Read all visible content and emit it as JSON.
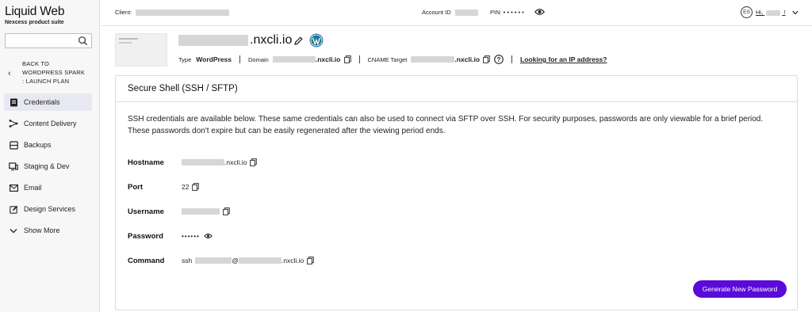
{
  "brand": {
    "name": "Liquid Web",
    "subtitle": "Nexcess product suite"
  },
  "sidebar": {
    "search_placeholder": "",
    "back_lines": [
      "BACK TO",
      "WORDPRESS SPARK",
      ": LAUNCH PLAN"
    ],
    "items": [
      {
        "label": "Credentials",
        "icon": "id-card-icon",
        "active": true
      },
      {
        "label": "Content Delivery",
        "icon": "network-icon"
      },
      {
        "label": "Backups",
        "icon": "archive-icon"
      },
      {
        "label": "Staging & Dev",
        "icon": "monitor-icon"
      },
      {
        "label": "Email",
        "icon": "envelope-icon"
      },
      {
        "label": "Design Services",
        "icon": "edit-icon"
      },
      {
        "label": "Show More",
        "icon": "chevron-down-icon"
      }
    ]
  },
  "topbar": {
    "client_label": "Client:",
    "account_label": "Account ID",
    "pin_label": "PIN: • • • • • •",
    "avatar_initials": "ES",
    "greeting_prefix": "Hi,",
    "greeting_suffix": "!"
  },
  "site": {
    "name_suffix": ".nxcli.io",
    "type_label": "Type",
    "type_value": "WordPress",
    "domain_label": "Domain",
    "domain_suffix": ".nxcli.io",
    "cname_label": "CNAME Target",
    "cname_suffix": ".nxcli.io",
    "ip_link": "Looking for an IP address?"
  },
  "ssh": {
    "title": "Secure Shell (SSH / SFTP)",
    "description": "SSH credentials are available below. These same credentials can also be used to connect via SFTP over SSH. For security purposes, passwords are only viewable for a brief period. These passwords don't expire but can be easily regenerated after the viewing period ends.",
    "hostname_label": "Hostname",
    "hostname_suffix": ".nxcli.io",
    "port_label": "Port",
    "port_value": "22",
    "username_label": "Username",
    "password_label": "Password",
    "password_mask": "••••••",
    "command_label": "Command",
    "command_prefix": "ssh",
    "command_at": "@",
    "command_suffix": ".nxcli.io",
    "button_label": "Generate New Password"
  },
  "colors": {
    "accent": "#5b0bd8",
    "active_nav": "#e8e8f2",
    "wordpress": "#21759b"
  }
}
